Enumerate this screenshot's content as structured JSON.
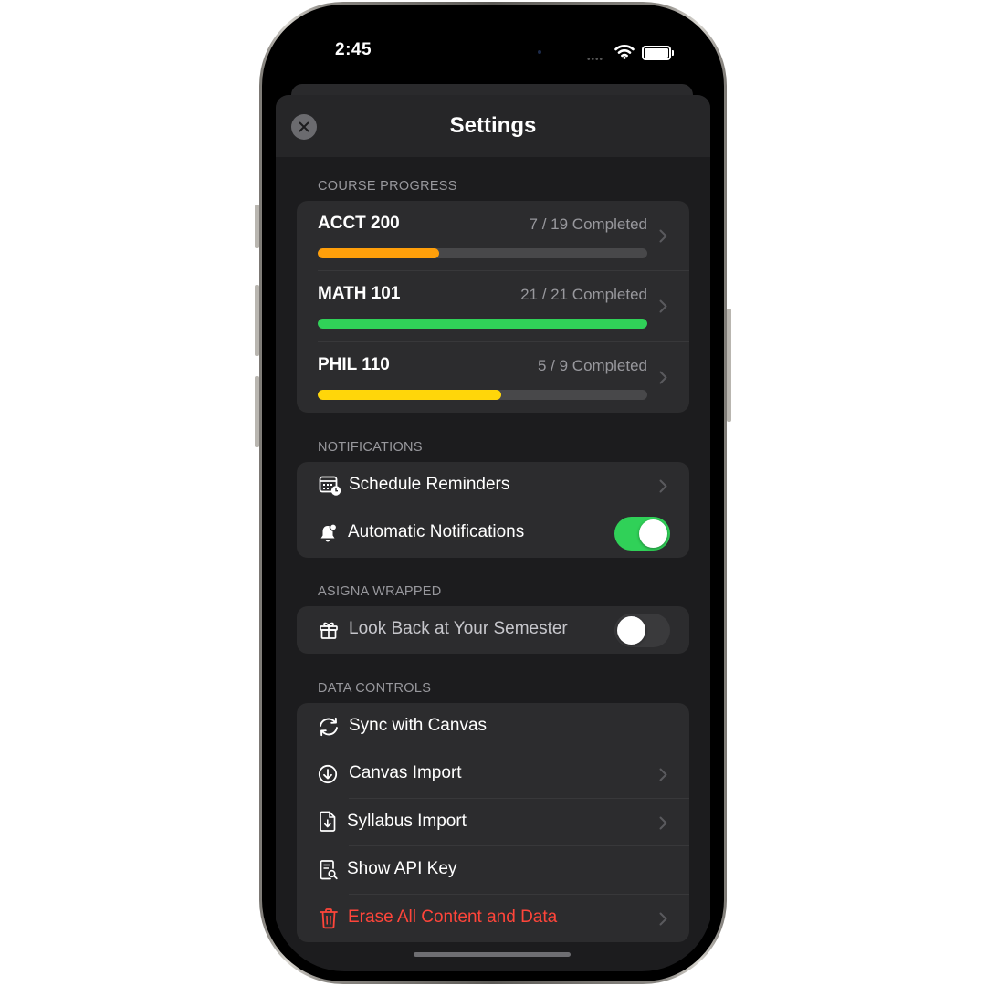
{
  "status_bar": {
    "time": "2:45"
  },
  "header": {
    "title": "Settings"
  },
  "course_progress": {
    "header": "COURSE PROGRESS",
    "courses": [
      {
        "name": "ACCT 200",
        "completed_text": "7 / 19 Completed",
        "progress": 0.368,
        "color": "#ff9f0a"
      },
      {
        "name": "MATH 101",
        "completed_text": "21 / 21 Completed",
        "progress": 1.0,
        "color": "#30d158"
      },
      {
        "name": "PHIL 110",
        "completed_text": "5 / 9 Completed",
        "progress": 0.556,
        "color": "#ffd60a"
      }
    ]
  },
  "notifications": {
    "header": "NOTIFICATIONS",
    "items": [
      {
        "label": "Schedule Reminders",
        "icon": "calendar-clock-icon"
      },
      {
        "label": "Automatic Notifications",
        "icon": "bell-icon",
        "toggle_on": true
      }
    ]
  },
  "wrapped": {
    "header": "ASIGNA WRAPPED",
    "item": {
      "label": "Look Back at Your Semester",
      "icon": "gift-icon",
      "toggle_on": false
    }
  },
  "data_controls": {
    "header": "DATA CONTROLS",
    "items": [
      {
        "label": "Sync with Canvas",
        "icon": "sync-icon"
      },
      {
        "label": "Canvas Import",
        "icon": "download-circle-icon"
      },
      {
        "label": "Syllabus Import",
        "icon": "document-download-icon"
      },
      {
        "label": "Show API Key",
        "icon": "document-search-icon"
      },
      {
        "label": "Erase All Content and Data",
        "icon": "trash-icon",
        "color": "#ff453a"
      }
    ]
  },
  "colors": {
    "toggle_on": "#30d158",
    "toggle_off": "#3a3a3c",
    "destructive": "#ff453a"
  }
}
